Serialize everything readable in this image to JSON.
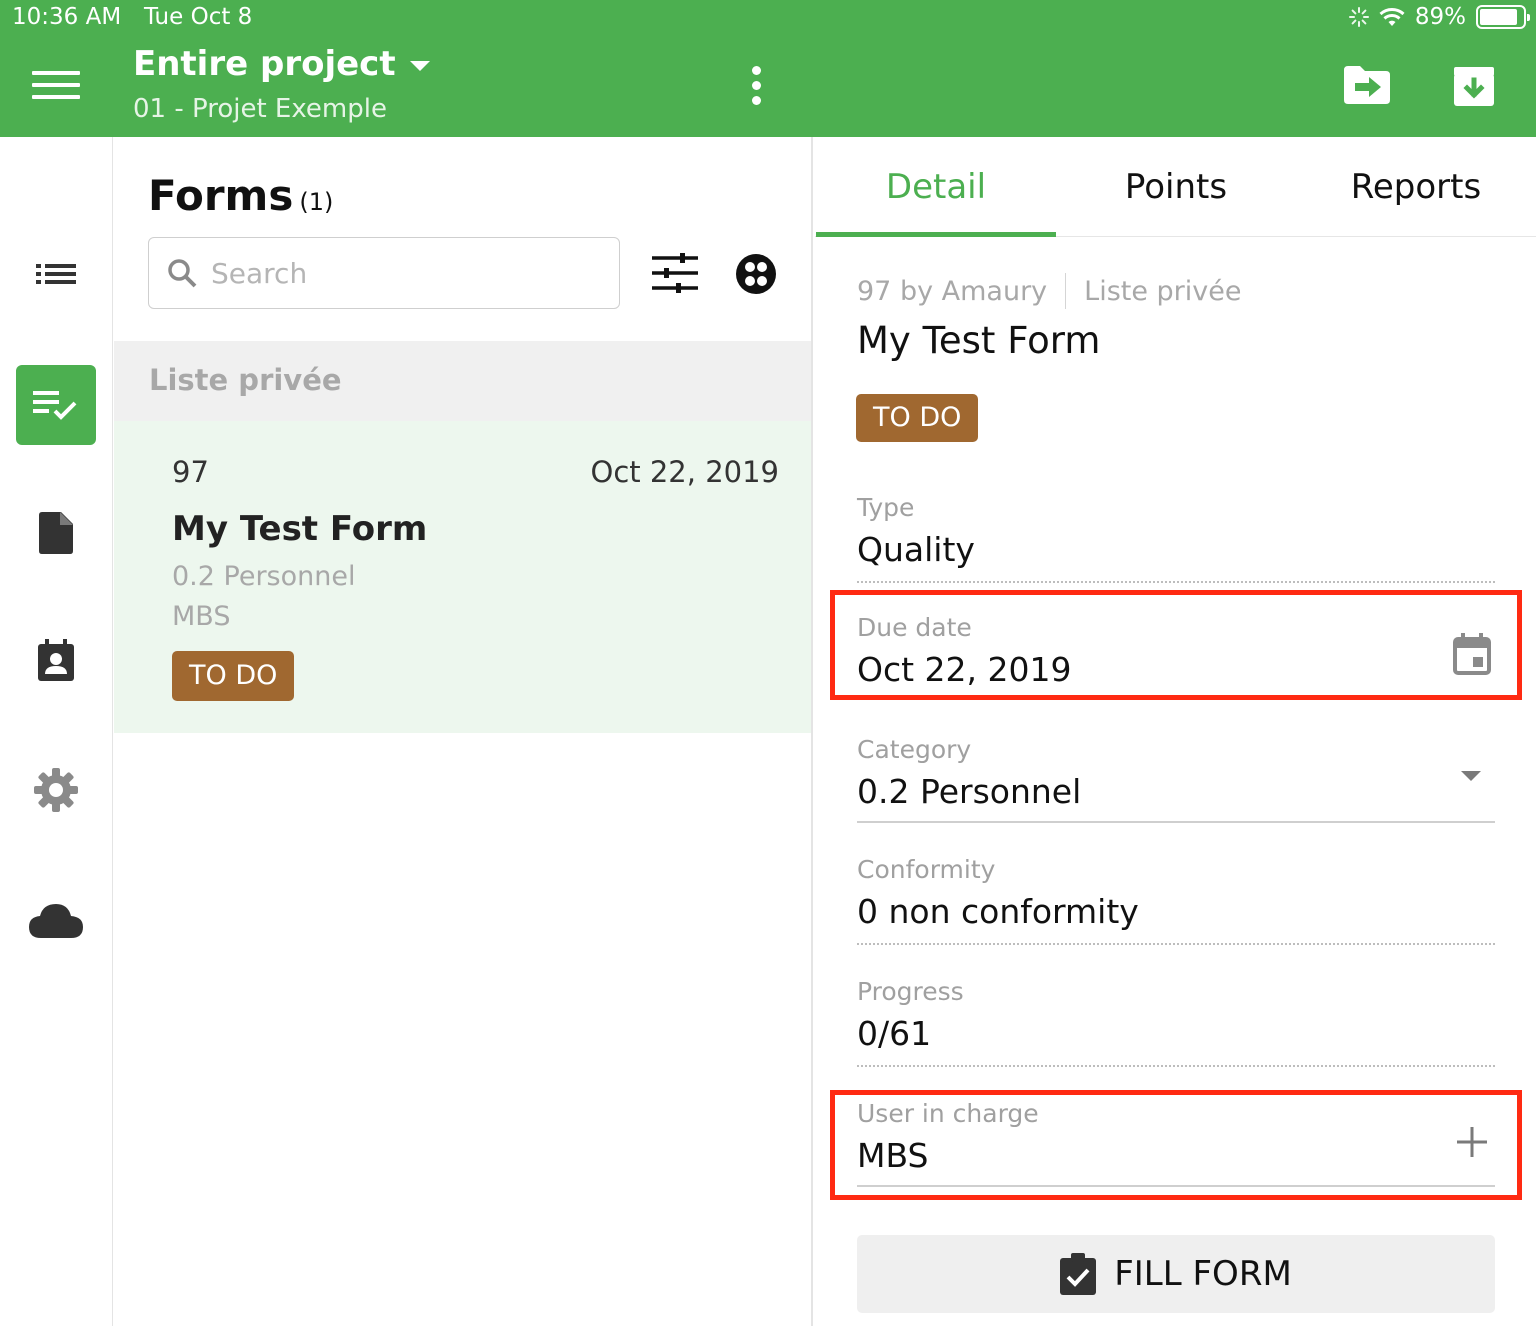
{
  "status_bar": {
    "time": "10:36 AM",
    "date": "Tue Oct 8",
    "battery": "89%",
    "battery_level": 0.89
  },
  "header": {
    "title": "Entire project",
    "subtitle": "01 - Projet Exemple",
    "icons": [
      "menu-icon",
      "caret-down-icon",
      "more-vert-icon",
      "export-icon",
      "archive-download-icon"
    ]
  },
  "sidebar": {
    "items": [
      {
        "name": "list-icon",
        "active": false
      },
      {
        "name": "forms-checklist-icon",
        "active": true
      },
      {
        "name": "document-icon",
        "active": false
      },
      {
        "name": "contacts-icon",
        "active": false
      },
      {
        "name": "settings-gear-icon",
        "active": false
      },
      {
        "name": "cloud-icon",
        "active": false
      }
    ]
  },
  "list": {
    "title": "Forms",
    "count": "(1)",
    "search_placeholder": "Search",
    "search_value": "",
    "section_label": "Liste privée",
    "items": [
      {
        "number": "97",
        "date": "Oct 22, 2019",
        "title": "My Test Form",
        "category": "0.2 Personnel",
        "user": "MBS",
        "status": "TO DO"
      }
    ]
  },
  "detail": {
    "tabs": [
      {
        "label": "Detail",
        "active": true
      },
      {
        "label": "Points",
        "active": false
      },
      {
        "label": "Reports",
        "active": false
      }
    ],
    "meta_left": "97 by Amaury",
    "meta_right": "Liste privée",
    "title": "My Test Form",
    "status": "TO DO",
    "fields": {
      "type": {
        "label": "Type",
        "value": "Quality"
      },
      "due_date": {
        "label": "Due date",
        "value": "Oct 22, 2019"
      },
      "category": {
        "label": "Category",
        "value": "0.2 Personnel"
      },
      "conformity": {
        "label": "Conformity",
        "value": "0 non conformity"
      },
      "progress": {
        "label": "Progress",
        "value": "0/61"
      },
      "user_in_charge": {
        "label": "User in charge",
        "value": "MBS"
      }
    },
    "fill_button": "FILL FORM"
  },
  "colors": {
    "brand_green": "#4caf50",
    "status_todo": "#a06830",
    "highlight_red": "#ff2a12",
    "selected_row": "#edf7ee"
  }
}
